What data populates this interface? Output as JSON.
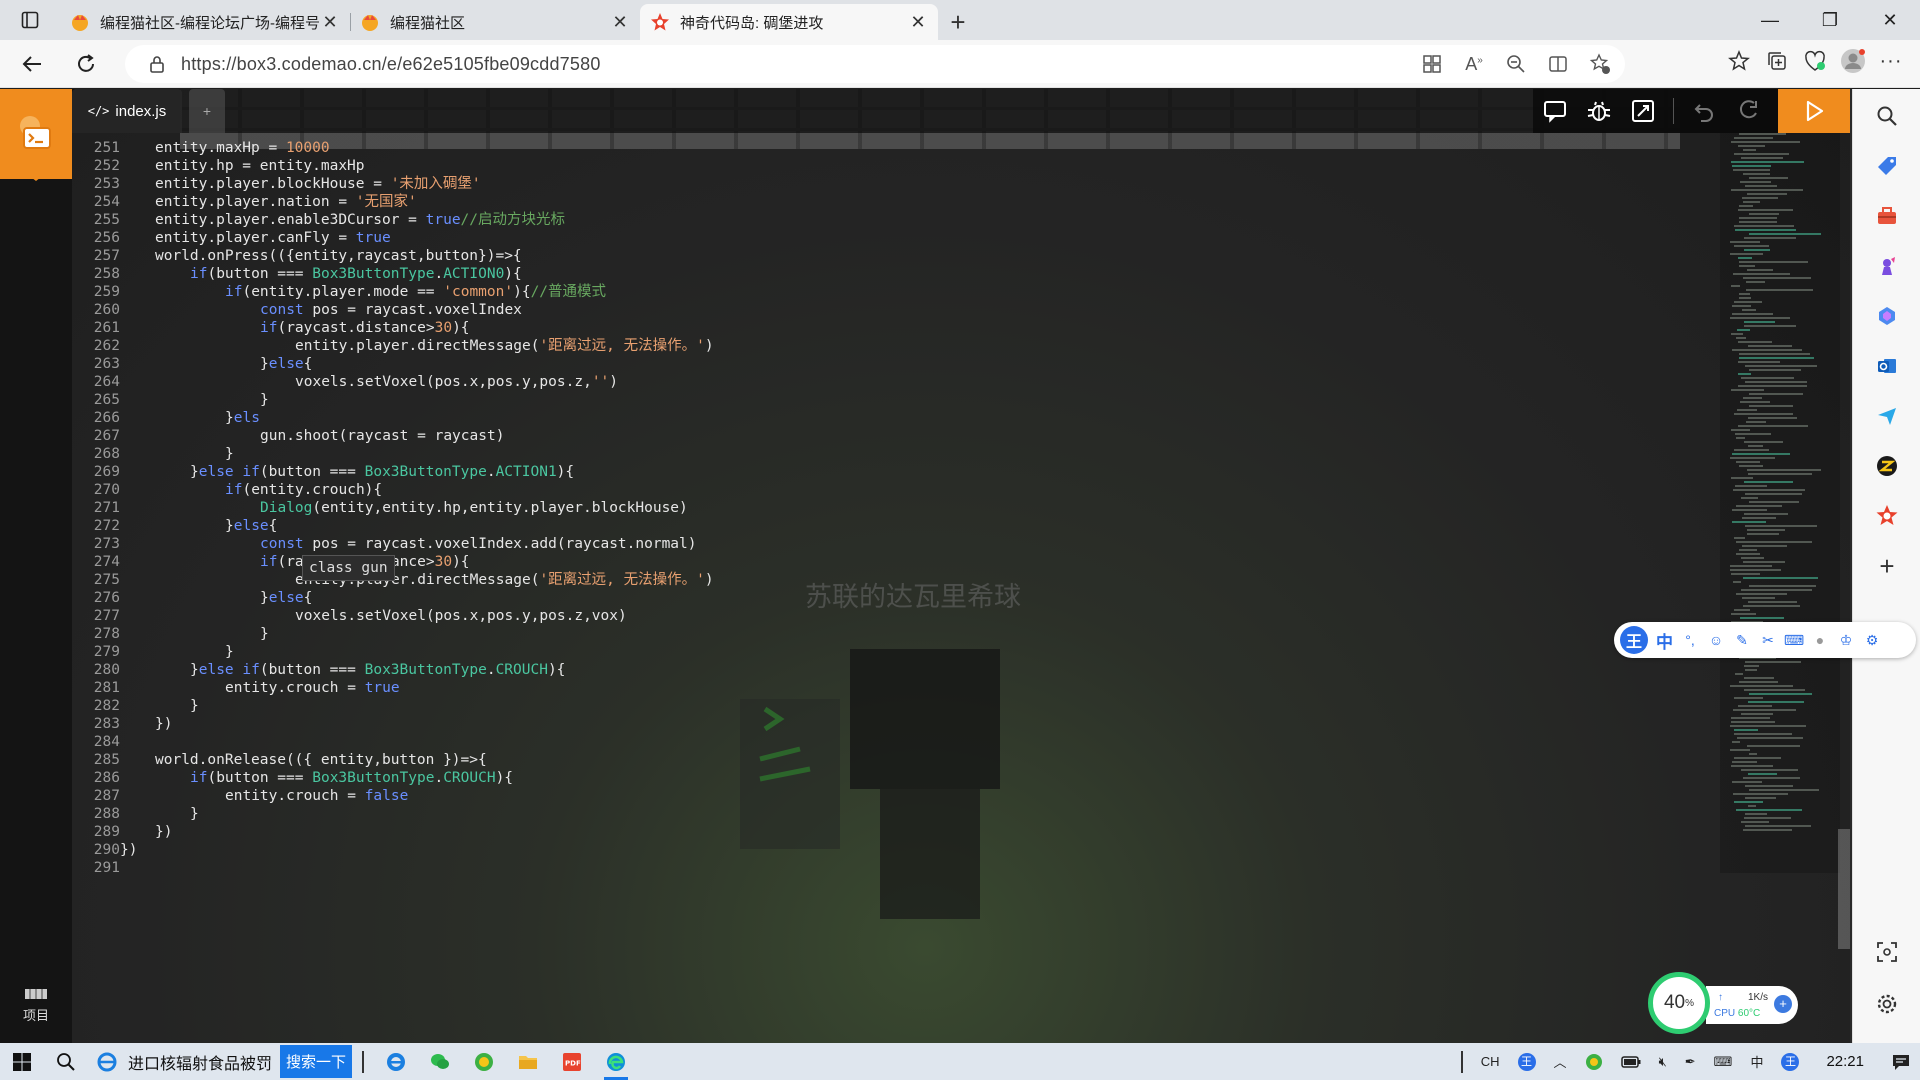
{
  "browser": {
    "tabs": [
      {
        "title": "编程猫社区-编程论坛广场-编程号",
        "active": false
      },
      {
        "title": "编程猫社区",
        "active": false
      },
      {
        "title": "神奇代码岛: 碉堡进攻",
        "active": true
      }
    ],
    "url": "https://box3.codemao.cn/e/e62e5105fbe09cdd7580"
  },
  "editor": {
    "file_tab": "index.js",
    "new_tab_label": "+",
    "project_label": "项目",
    "hint": "class gun",
    "ghost_text": "苏联的达瓦里希球",
    "lines": [
      {
        "n": "251",
        "indent": 4,
        "tokens": [
          [
            "",
            "entity.maxHp = "
          ],
          [
            "str",
            "10000"
          ]
        ]
      },
      {
        "n": "252",
        "indent": 4,
        "tokens": [
          [
            "",
            "entity.hp = entity.maxHp"
          ]
        ]
      },
      {
        "n": "253",
        "indent": 4,
        "tokens": [
          [
            "",
            "entity.player.blockHouse = "
          ],
          [
            "str",
            "'未加入碉堡'"
          ]
        ]
      },
      {
        "n": "254",
        "indent": 4,
        "tokens": [
          [
            "",
            "entity.player.nation = "
          ],
          [
            "str",
            "'无国家'"
          ]
        ]
      },
      {
        "n": "255",
        "indent": 4,
        "tokens": [
          [
            "",
            "entity.player.enable3DCursor = "
          ],
          [
            "kw",
            "true"
          ],
          [
            "cm",
            "//启动方块光标"
          ]
        ]
      },
      {
        "n": "256",
        "indent": 4,
        "tokens": [
          [
            "",
            "entity.player.canFly = "
          ],
          [
            "kw",
            "true"
          ]
        ]
      },
      {
        "n": "257",
        "indent": 4,
        "tokens": [
          [
            "",
            "world.onPress(({entity,raycast,button})=>{"
          ]
        ]
      },
      {
        "n": "258",
        "indent": 8,
        "tokens": [
          [
            "kw",
            "if"
          ],
          [
            "",
            "(button === "
          ],
          [
            "ty",
            "Box3ButtonType"
          ],
          [
            "",
            "."
          ],
          [
            "ty",
            "ACTION0"
          ],
          [
            "",
            "){"
          ]
        ]
      },
      {
        "n": "259",
        "indent": 12,
        "tokens": [
          [
            "kw",
            "if"
          ],
          [
            "",
            "(entity.player.mode == "
          ],
          [
            "str",
            "'common'"
          ],
          [
            "",
            "){"
          ],
          [
            "cm",
            "//普通模式"
          ]
        ]
      },
      {
        "n": "260",
        "indent": 16,
        "tokens": [
          [
            "kw",
            "const"
          ],
          [
            "",
            " pos = raycast.voxelIndex"
          ]
        ]
      },
      {
        "n": "261",
        "indent": 16,
        "tokens": [
          [
            "kw",
            "if"
          ],
          [
            "",
            "(raycast.distance>"
          ],
          [
            "str",
            "30"
          ],
          [
            "",
            "){"
          ]
        ]
      },
      {
        "n": "262",
        "indent": 20,
        "tokens": [
          [
            "",
            "entity.player.directMessage("
          ],
          [
            "str",
            "'距离过远, 无法操作。'"
          ],
          [
            "",
            ")"
          ]
        ]
      },
      {
        "n": "263",
        "indent": 16,
        "tokens": [
          [
            "",
            "}"
          ],
          [
            "kw",
            "else"
          ],
          [
            "",
            "{"
          ]
        ]
      },
      {
        "n": "264",
        "indent": 20,
        "tokens": [
          [
            "",
            "voxels.setVoxel(pos.x,pos.y,pos.z,"
          ],
          [
            "str",
            "''"
          ],
          [
            "",
            ")"
          ]
        ]
      },
      {
        "n": "265",
        "indent": 16,
        "tokens": [
          [
            "",
            "}"
          ]
        ]
      },
      {
        "n": "266",
        "indent": 12,
        "tokens": [
          [
            "",
            "}"
          ],
          [
            "kw",
            "els"
          ]
        ]
      },
      {
        "n": "267",
        "indent": 16,
        "tokens": [
          [
            "",
            "gun.shoot(raycast = raycast)"
          ]
        ]
      },
      {
        "n": "268",
        "indent": 12,
        "tokens": [
          [
            "",
            "}"
          ]
        ]
      },
      {
        "n": "269",
        "indent": 8,
        "tokens": [
          [
            "",
            "}"
          ],
          [
            "kw",
            "else if"
          ],
          [
            "",
            "(button === "
          ],
          [
            "ty",
            "Box3ButtonType"
          ],
          [
            "",
            "."
          ],
          [
            "ty",
            "ACTION1"
          ],
          [
            "",
            "){"
          ]
        ]
      },
      {
        "n": "270",
        "indent": 12,
        "tokens": [
          [
            "kw",
            "if"
          ],
          [
            "",
            "(entity.crouch){"
          ]
        ]
      },
      {
        "n": "271",
        "indent": 16,
        "tokens": [
          [
            "ty",
            "Dialog"
          ],
          [
            "",
            "(entity,entity.hp,entity.player.blockHouse)"
          ]
        ]
      },
      {
        "n": "272",
        "indent": 12,
        "tokens": [
          [
            "",
            "}"
          ],
          [
            "kw",
            "else"
          ],
          [
            "",
            "{"
          ]
        ]
      },
      {
        "n": "273",
        "indent": 16,
        "tokens": [
          [
            "kw",
            "const"
          ],
          [
            "",
            " pos = raycast.voxelIndex.add(raycast.normal)"
          ]
        ]
      },
      {
        "n": "274",
        "indent": 16,
        "tokens": [
          [
            "kw",
            "if"
          ],
          [
            "",
            "(raycast.distance>"
          ],
          [
            "str",
            "30"
          ],
          [
            "",
            "){"
          ]
        ]
      },
      {
        "n": "275",
        "indent": 20,
        "tokens": [
          [
            "",
            "entity.player.directMessage("
          ],
          [
            "str",
            "'距离过远, 无法操作。'"
          ],
          [
            "",
            ")"
          ]
        ]
      },
      {
        "n": "276",
        "indent": 16,
        "tokens": [
          [
            "",
            "}"
          ],
          [
            "kw",
            "else"
          ],
          [
            "",
            "{"
          ]
        ]
      },
      {
        "n": "277",
        "indent": 20,
        "tokens": [
          [
            "",
            "voxels.setVoxel(pos.x,pos.y,pos.z,vox)"
          ]
        ]
      },
      {
        "n": "278",
        "indent": 16,
        "tokens": [
          [
            "",
            "}"
          ]
        ]
      },
      {
        "n": "279",
        "indent": 12,
        "tokens": [
          [
            "",
            "}"
          ]
        ]
      },
      {
        "n": "280",
        "indent": 8,
        "tokens": [
          [
            "",
            "}"
          ],
          [
            "kw",
            "else if"
          ],
          [
            "",
            "(button === "
          ],
          [
            "ty",
            "Box3ButtonType"
          ],
          [
            "",
            "."
          ],
          [
            "ty",
            "CROUCH"
          ],
          [
            "",
            "){"
          ]
        ]
      },
      {
        "n": "281",
        "indent": 12,
        "tokens": [
          [
            "",
            "entity.crouch = "
          ],
          [
            "kw",
            "true"
          ]
        ]
      },
      {
        "n": "282",
        "indent": 8,
        "tokens": [
          [
            "",
            "}"
          ]
        ]
      },
      {
        "n": "283",
        "indent": 4,
        "tokens": [
          [
            "",
            "})"
          ]
        ]
      },
      {
        "n": "284",
        "indent": 0,
        "tokens": []
      },
      {
        "n": "285",
        "indent": 4,
        "tokens": [
          [
            "",
            "world.onRelease(({ entity,button })=>{"
          ]
        ]
      },
      {
        "n": "286",
        "indent": 8,
        "tokens": [
          [
            "kw",
            "if"
          ],
          [
            "",
            "(button === "
          ],
          [
            "ty",
            "Box3ButtonType"
          ],
          [
            "",
            "."
          ],
          [
            "ty",
            "CROUCH"
          ],
          [
            "",
            "){"
          ]
        ]
      },
      {
        "n": "287",
        "indent": 12,
        "tokens": [
          [
            "",
            "entity.crouch = "
          ],
          [
            "kw",
            "false"
          ]
        ]
      },
      {
        "n": "288",
        "indent": 8,
        "tokens": [
          [
            "",
            "}"
          ]
        ]
      },
      {
        "n": "289",
        "indent": 4,
        "tokens": [
          [
            "",
            "})"
          ]
        ]
      },
      {
        "n": "290",
        "indent": 0,
        "tokens": [
          [
            "",
            "})"
          ]
        ]
      },
      {
        "n": "291",
        "indent": 0,
        "tokens": []
      }
    ]
  },
  "ime": {
    "logo": "王",
    "mode": "中",
    "punct": "°,"
  },
  "perf": {
    "percent": "40",
    "percent_unit": "%",
    "net_speed": "1K/s",
    "cpu_label": "CPU",
    "cpu_temp": "60°C"
  },
  "taskbar": {
    "search_text": "进口核辐射食品被罚",
    "search_button": "搜索一下",
    "tray_lang": "CH",
    "tray_ime": "中",
    "clock": "22:21"
  },
  "colors": {
    "accent": "#f08c1e",
    "keyword": "#6a8fff",
    "string": "#e8a070",
    "comment": "#68a860",
    "type": "#4ac6a0"
  }
}
